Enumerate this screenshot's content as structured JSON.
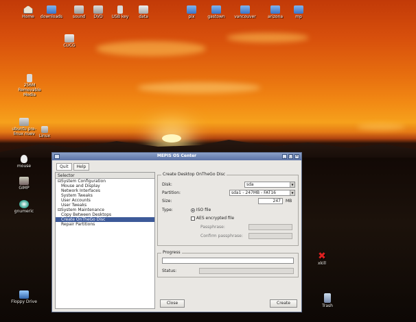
{
  "desktop": {
    "top_icons": [
      {
        "label": "Home",
        "icon": "home-icon"
      },
      {
        "label": "downloads",
        "icon": "folder-icon"
      },
      {
        "label": "sound",
        "icon": "speaker-icon"
      },
      {
        "label": "DVD",
        "icon": "dvd-icon"
      },
      {
        "label": "USB key",
        "icon": "usb-icon"
      },
      {
        "label": "data",
        "icon": "drive-icon"
      },
      {
        "label": "pix",
        "icon": "folder-icon"
      },
      {
        "label": "gastown",
        "icon": "folder-icon"
      },
      {
        "label": "vancouver",
        "icon": "folder-icon"
      },
      {
        "label": "arizona",
        "icon": "folder-icon"
      },
      {
        "label": "mp",
        "icon": "folder-icon"
      }
    ],
    "side_icons": [
      {
        "label": "CUCG",
        "icon": "drive-icon"
      },
      {
        "label": "256M Removable Media",
        "icon": "usb-icon"
      },
      {
        "label": "ubuntu pre-linux nuev",
        "icon": "hdd-icon"
      },
      {
        "label": "Linux",
        "icon": "linux-icon"
      },
      {
        "label": "mouse",
        "icon": "mouse-icon"
      },
      {
        "label": "GIMP",
        "icon": "gimp-icon"
      },
      {
        "label": "gnumeric",
        "icon": "chat-icon"
      },
      {
        "label": "xkill",
        "icon": "xkill-icon"
      },
      {
        "label": "Floppy Drive",
        "icon": "floppy-icon"
      },
      {
        "label": "Trash",
        "icon": "trash-icon"
      }
    ]
  },
  "window": {
    "title": "MEPIS OS Center",
    "menu": [
      "Quit",
      "Help"
    ],
    "selector": {
      "header": "Selector",
      "items": [
        {
          "label": "System Configuration",
          "category": true
        },
        {
          "label": "Mouse and Display"
        },
        {
          "label": "Network Interfaces"
        },
        {
          "label": "System Tweaks"
        },
        {
          "label": "User Accounts"
        },
        {
          "label": "User Tweaks"
        },
        {
          "label": "System Maintenance",
          "category": true
        },
        {
          "label": "Copy Between Desktops"
        },
        {
          "label": "Create OnTheGo Disc",
          "selected": true
        },
        {
          "label": "Repair Partitions"
        }
      ]
    },
    "create_group": {
      "title": "Create Desktop OnTheGo Disc",
      "disk_label": "Disk:",
      "disk_value": "sda",
      "partition_label": "Partition:",
      "partition_value": "sda1 - 247MB - FAT16",
      "size_label": "Size:",
      "size_value": "247",
      "size_unit": "MB",
      "type_label": "Type:",
      "iso_label": "ISO file",
      "aes_label": "AES encrypted file",
      "passphrase_label": "Passphrase:",
      "confirm_label": "Confirm passphrase:"
    },
    "progress_group": {
      "title": "Progress",
      "progress": 0.0,
      "status_label": "Status:",
      "status_value": ""
    },
    "buttons": {
      "close": "Close",
      "create": "Create"
    }
  }
}
